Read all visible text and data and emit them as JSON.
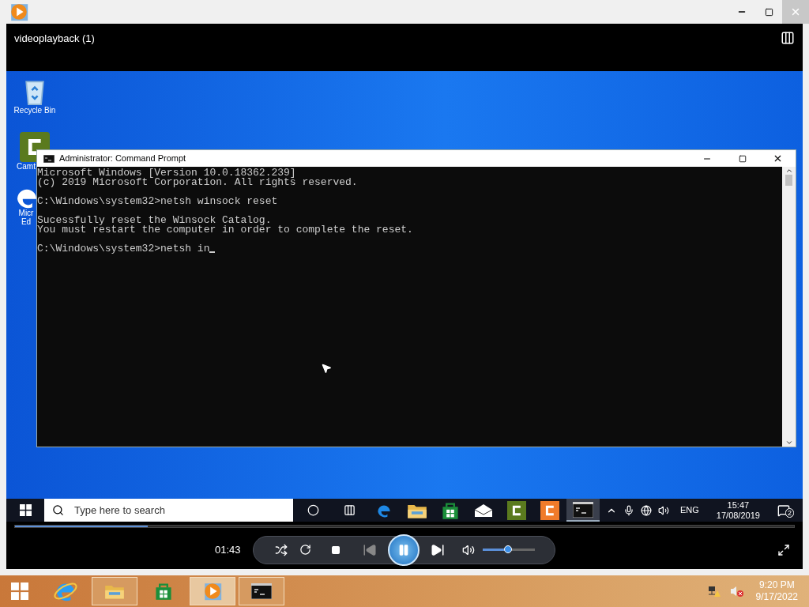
{
  "player": {
    "title": "videoplayback (1)",
    "seek": {
      "level": 0.17
    },
    "time": "01:43",
    "volume": {
      "level": 0.48
    }
  },
  "video": {
    "desktop_icons": [
      {
        "kind": "recycle",
        "label": "Recycle Bin"
      },
      {
        "kind": "camtasia",
        "label": "Camt"
      },
      {
        "kind": "edge",
        "label": "Micr Ed"
      }
    ],
    "console": {
      "title": "Administrator: Command Prompt",
      "blocks": [
        [
          "Microsoft Windows [Version 10.0.18362.239]",
          "(c) 2019 Microsoft Corporation. All rights reserved."
        ],
        [
          "C:\\Windows\\system32>netsh winsock reset"
        ],
        [
          "Sucessfully reset the Winsock Catalog.",
          "You must restart the computer in order to complete the reset."
        ],
        [
          "C:\\Windows\\system32>netsh in"
        ]
      ]
    },
    "taskbar": {
      "search": {
        "placeholder": "Type here to search"
      },
      "apps": [
        {
          "kind": "edge",
          "selected": false
        },
        {
          "kind": "explorer",
          "selected": false
        },
        {
          "kind": "store",
          "selected": false
        },
        {
          "kind": "mail",
          "selected": false
        },
        {
          "kind": "camtasia",
          "selected": false
        },
        {
          "kind": "recorder",
          "selected": false
        },
        {
          "kind": "cmd",
          "selected": true
        }
      ],
      "language": "ENG",
      "time": "15:47",
      "date": "17/08/2019",
      "notifications": "2"
    }
  },
  "host_taskbar": {
    "apps": [
      {
        "kind": "ie",
        "running": false,
        "selected": false
      },
      {
        "kind": "explorer",
        "running": true,
        "selected": false
      },
      {
        "kind": "store",
        "running": false,
        "selected": false
      },
      {
        "kind": "player",
        "running": true,
        "selected": true
      },
      {
        "kind": "cmd",
        "running": true,
        "selected": false
      }
    ],
    "time": "9:20 PM",
    "date": "9/17/2022"
  }
}
